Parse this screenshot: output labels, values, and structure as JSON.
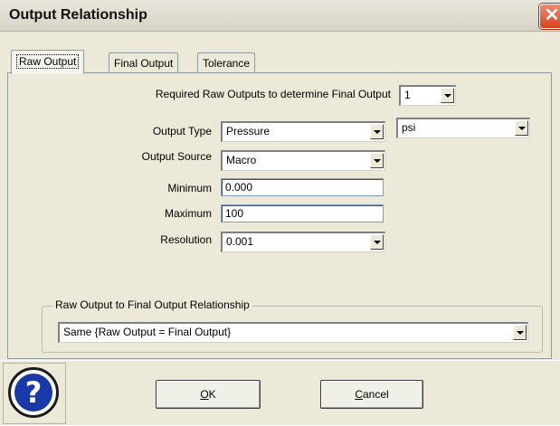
{
  "window": {
    "title": "Output Relationship",
    "close": "✕"
  },
  "tabs": [
    {
      "label": "Raw Output",
      "active": true
    },
    {
      "label": "Final Output",
      "active": false
    },
    {
      "label": "Tolerance",
      "active": false
    }
  ],
  "form": {
    "required_label": "Required Raw Outputs to determine Final Output",
    "required_value": "1",
    "output_type_label": "Output Type",
    "output_type_value": "Pressure",
    "unit_value": "psi",
    "output_source_label": "Output Source",
    "output_source_value": "Macro",
    "minimum_label": "Minimum",
    "minimum_value": "0.000",
    "maximum_label": "Maximum",
    "maximum_value": "100",
    "resolution_label": "Resolution",
    "resolution_value": "0.001"
  },
  "relationship": {
    "group_label": "Raw Output to Final Output Relationship",
    "value": "Same {Raw Output = Final Output}"
  },
  "buttons": {
    "ok_prefix": "",
    "ok_mnemonic": "O",
    "ok_rest": "K",
    "cancel_mnemonic": "C",
    "cancel_rest": "ancel",
    "help_glyph": "?"
  }
}
